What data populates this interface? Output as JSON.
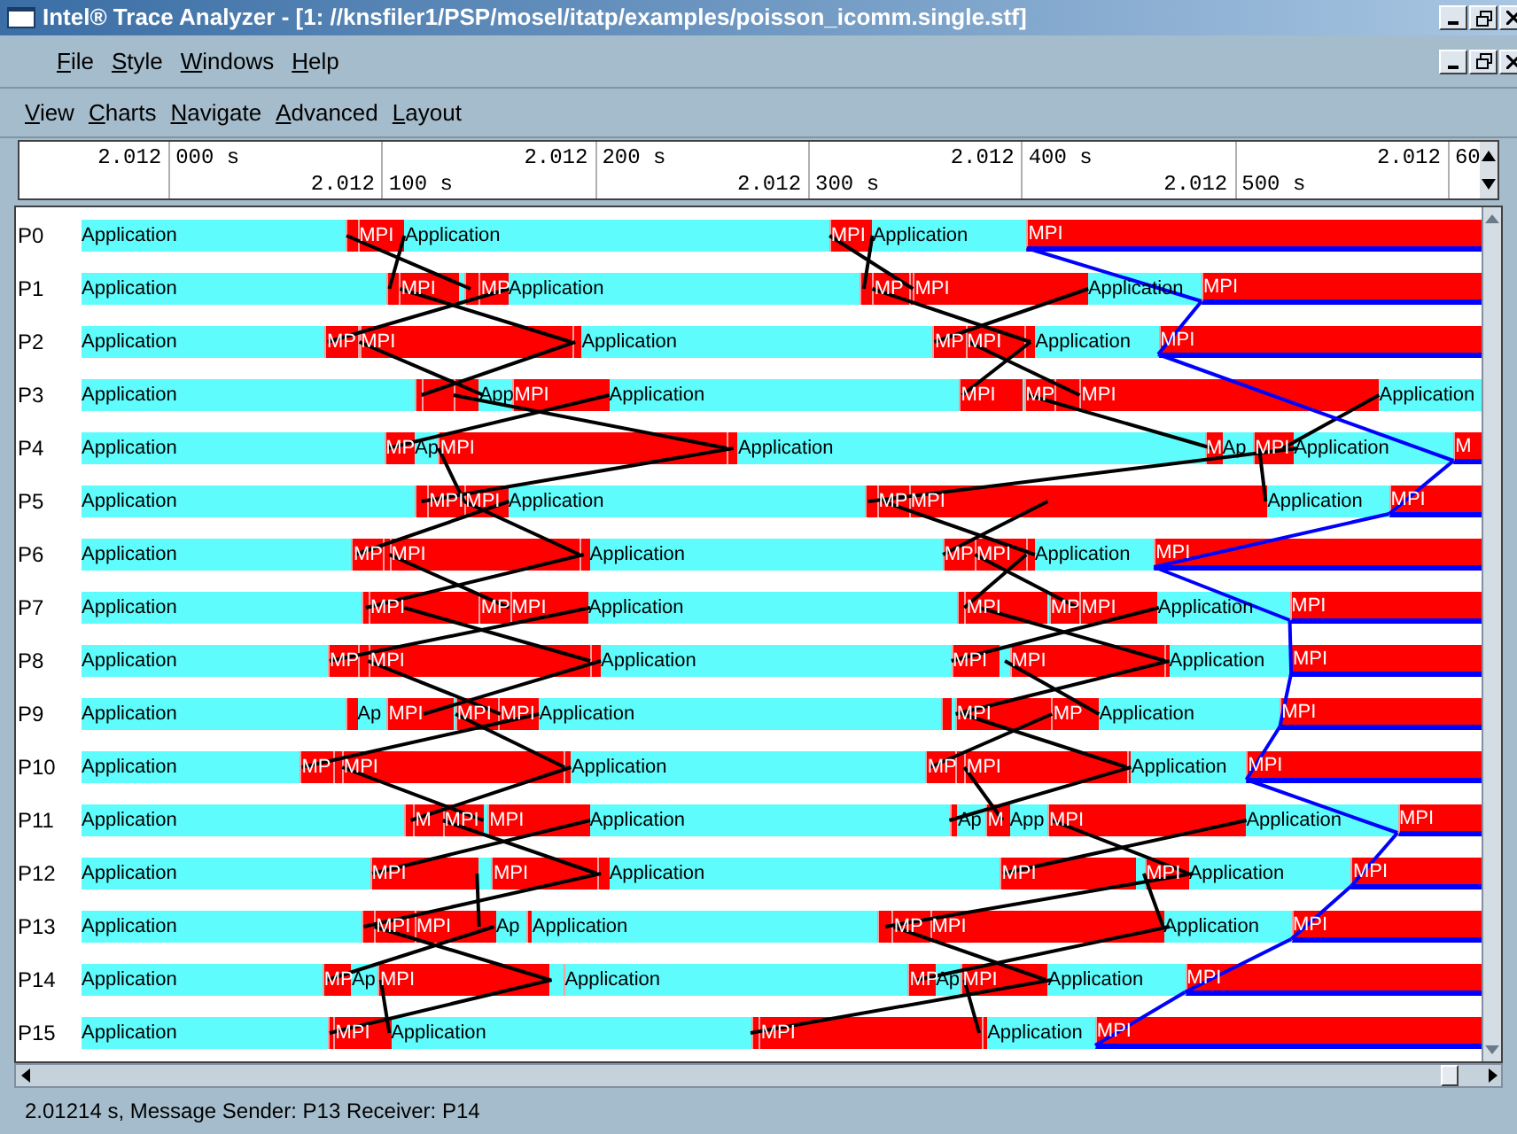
{
  "window": {
    "title": "Intel® Trace Analyzer - [1: //knsfiler1/PSP/mosel/itatp/examples/poisson_icomm.single.stf]"
  },
  "menu_bar": [
    "File",
    "Style",
    "Windows",
    "Help"
  ],
  "chart_menu": [
    "View",
    "Charts",
    "Navigate",
    "Advanced",
    "Layout"
  ],
  "ruler": {
    "ticks": [
      {
        "prefix": "2.012",
        "suffix": "000 s"
      },
      {
        "prefix": "2.012",
        "suffix": "100 s"
      },
      {
        "prefix": "2.012",
        "suffix": "200 s"
      },
      {
        "prefix": "2.012",
        "suffix": "300 s"
      },
      {
        "prefix": "2.012",
        "suffix": "400 s"
      },
      {
        "prefix": "2.012",
        "suffix": "500 s"
      },
      {
        "prefix": "2.012",
        "suffix": "60"
      }
    ]
  },
  "trace": {
    "rows": [
      {
        "process": "P0",
        "segments": [
          {
            "kind": "app",
            "label": "Application"
          },
          {
            "kind": "mpi"
          },
          {
            "kind": "mpi",
            "label": "MPI"
          },
          {
            "kind": "app",
            "label": "Application"
          },
          {
            "kind": "mpi",
            "label": "MPI"
          },
          {
            "kind": "app",
            "label": "Application"
          },
          {
            "kind": "mpi",
            "label": "MPI",
            "collective": true
          }
        ]
      },
      {
        "process": "P1",
        "segments": [
          {
            "kind": "app",
            "label": "Application"
          },
          {
            "kind": "mpi"
          },
          {
            "kind": "mpi",
            "label": "MPI"
          },
          {
            "kind": "app"
          },
          {
            "kind": "mpi"
          },
          {
            "kind": "mpi",
            "label": "MP"
          },
          {
            "kind": "app",
            "label": "Application"
          },
          {
            "kind": "mpi"
          },
          {
            "kind": "mpi",
            "label": "MP"
          },
          {
            "kind": "mpi"
          },
          {
            "kind": "mpi",
            "label": "MPI"
          },
          {
            "kind": "app",
            "label": "Application"
          },
          {
            "kind": "mpi",
            "label": "MPI",
            "collective": true
          }
        ]
      },
      {
        "process": "P2",
        "segments": [
          {
            "kind": "app",
            "label": "Application"
          },
          {
            "kind": "mpi",
            "label": "MP"
          },
          {
            "kind": "mpi"
          },
          {
            "kind": "mpi",
            "label": "MPI"
          },
          {
            "kind": "mpi"
          },
          {
            "kind": "app",
            "label": "Application"
          },
          {
            "kind": "mpi",
            "label": "MP"
          },
          {
            "kind": "mpi",
            "label": "MPI"
          },
          {
            "kind": "mpi"
          },
          {
            "kind": "app",
            "label": "Application"
          },
          {
            "kind": "mpi",
            "label": "MPI",
            "collective": true
          }
        ]
      },
      {
        "process": "P3",
        "segments": [
          {
            "kind": "app",
            "label": "Application"
          },
          {
            "kind": "mpi"
          },
          {
            "kind": "mpi"
          },
          {
            "kind": "mpi"
          },
          {
            "kind": "app",
            "label": "App"
          },
          {
            "kind": "mpi",
            "label": "MPI"
          },
          {
            "kind": "app",
            "label": "Application"
          },
          {
            "kind": "mpi",
            "label": "MPI"
          },
          {
            "kind": "app"
          },
          {
            "kind": "mpi",
            "label": "MP"
          },
          {
            "kind": "mpi"
          },
          {
            "kind": "mpi",
            "label": "MPI"
          },
          {
            "kind": "app",
            "label": "Application"
          }
        ]
      },
      {
        "process": "P4",
        "segments": [
          {
            "kind": "app",
            "label": "Application"
          },
          {
            "kind": "mpi",
            "label": "MP"
          },
          {
            "kind": "app",
            "label": "Ap"
          },
          {
            "kind": "mpi",
            "label": "MPI"
          },
          {
            "kind": "mpi"
          },
          {
            "kind": "app",
            "label": "Application"
          },
          {
            "kind": "mpi",
            "label": "M"
          },
          {
            "kind": "app",
            "label": "Ap"
          },
          {
            "kind": "mpi",
            "label": "MPI"
          },
          {
            "kind": "app",
            "label": "Application"
          },
          {
            "kind": "mpi",
            "label": "M",
            "collective": true
          }
        ]
      },
      {
        "process": "P5",
        "segments": [
          {
            "kind": "app",
            "label": "Application"
          },
          {
            "kind": "mpi"
          },
          {
            "kind": "mpi",
            "label": "MPI"
          },
          {
            "kind": "mpi",
            "label": "MPI"
          },
          {
            "kind": "app",
            "label": "Application"
          },
          {
            "kind": "mpi"
          },
          {
            "kind": "mpi",
            "label": "MP"
          },
          {
            "kind": "mpi",
            "label": "MPI"
          },
          {
            "kind": "app",
            "label": "Application"
          },
          {
            "kind": "mpi",
            "label": "MPI",
            "collective": true
          }
        ]
      },
      {
        "process": "P6",
        "segments": [
          {
            "kind": "app",
            "label": "Application"
          },
          {
            "kind": "mpi",
            "label": "MP"
          },
          {
            "kind": "mpi"
          },
          {
            "kind": "mpi",
            "label": "MPI"
          },
          {
            "kind": "mpi"
          },
          {
            "kind": "app",
            "label": "Application"
          },
          {
            "kind": "mpi",
            "label": "MP"
          },
          {
            "kind": "mpi",
            "label": "MPI"
          },
          {
            "kind": "mpi"
          },
          {
            "kind": "app",
            "label": "Application"
          },
          {
            "kind": "mpi",
            "label": "MPI",
            "collective": true
          }
        ]
      },
      {
        "process": "P7",
        "segments": [
          {
            "kind": "app",
            "label": "Application"
          },
          {
            "kind": "mpi"
          },
          {
            "kind": "mpi",
            "label": "MPI"
          },
          {
            "kind": "app"
          },
          {
            "kind": "mpi",
            "label": "MP"
          },
          {
            "kind": "mpi",
            "label": "MPI"
          },
          {
            "kind": "app",
            "label": "Application"
          },
          {
            "kind": "mpi"
          },
          {
            "kind": "mpi",
            "label": "MPI"
          },
          {
            "kind": "app"
          },
          {
            "kind": "mpi",
            "label": "MP"
          },
          {
            "kind": "mpi",
            "label": "MPI"
          },
          {
            "kind": "app",
            "label": "Application"
          },
          {
            "kind": "mpi",
            "label": "MPI",
            "collective": true
          }
        ]
      },
      {
        "process": "P8",
        "segments": [
          {
            "kind": "app",
            "label": "Application"
          },
          {
            "kind": "mpi",
            "label": "MP"
          },
          {
            "kind": "mpi"
          },
          {
            "kind": "mpi",
            "label": "MPI"
          },
          {
            "kind": "mpi"
          },
          {
            "kind": "app",
            "label": "Application"
          },
          {
            "kind": "mpi",
            "label": "MPI"
          },
          {
            "kind": "app"
          },
          {
            "kind": "mpi",
            "label": "MPI"
          },
          {
            "kind": "mpi"
          },
          {
            "kind": "app",
            "label": "Application"
          },
          {
            "kind": "mpi",
            "label": "MPI",
            "collective": true
          }
        ]
      },
      {
        "process": "P9",
        "segments": [
          {
            "kind": "app",
            "label": "Application"
          },
          {
            "kind": "mpi"
          },
          {
            "kind": "app",
            "label": "Ap"
          },
          {
            "kind": "mpi",
            "label": "MPI"
          },
          {
            "kind": "app"
          },
          {
            "kind": "mpi",
            "label": "MPI"
          },
          {
            "kind": "mpi",
            "label": "MPI"
          },
          {
            "kind": "app",
            "label": "Application"
          },
          {
            "kind": "mpi"
          },
          {
            "kind": "app"
          },
          {
            "kind": "mpi",
            "label": "MPI"
          },
          {
            "kind": "mpi",
            "label": "MP"
          },
          {
            "kind": "app",
            "label": "Application"
          },
          {
            "kind": "mpi",
            "label": "MPI",
            "collective": true
          }
        ]
      },
      {
        "process": "P10",
        "segments": [
          {
            "kind": "app",
            "label": "Application"
          },
          {
            "kind": "mpi",
            "label": "MP"
          },
          {
            "kind": "mpi"
          },
          {
            "kind": "mpi",
            "label": "MPI"
          },
          {
            "kind": "mpi"
          },
          {
            "kind": "app",
            "label": "Application"
          },
          {
            "kind": "mpi",
            "label": "MP"
          },
          {
            "kind": "mpi"
          },
          {
            "kind": "mpi",
            "label": "MPI"
          },
          {
            "kind": "mpi"
          },
          {
            "kind": "app",
            "label": "Application"
          },
          {
            "kind": "mpi",
            "label": "MPI",
            "collective": true
          }
        ]
      },
      {
        "process": "P11",
        "segments": [
          {
            "kind": "app",
            "label": "Application"
          },
          {
            "kind": "mpi"
          },
          {
            "kind": "mpi",
            "label": "M"
          },
          {
            "kind": "mpi",
            "label": "MPI"
          },
          {
            "kind": "app"
          },
          {
            "kind": "mpi",
            "label": "MPI"
          },
          {
            "kind": "app",
            "label": "Application"
          },
          {
            "kind": "mpi"
          },
          {
            "kind": "app",
            "label": "Ap"
          },
          {
            "kind": "mpi",
            "label": "M"
          },
          {
            "kind": "app",
            "label": "App"
          },
          {
            "kind": "mpi",
            "label": "MPI"
          },
          {
            "kind": "app",
            "label": "Application"
          },
          {
            "kind": "mpi",
            "label": "MPI",
            "collective": true
          }
        ]
      },
      {
        "process": "P12",
        "segments": [
          {
            "kind": "app",
            "label": "Application"
          },
          {
            "kind": "mpi",
            "label": "MPI"
          },
          {
            "kind": "app"
          },
          {
            "kind": "mpi",
            "label": "MPI"
          },
          {
            "kind": "mpi"
          },
          {
            "kind": "app",
            "label": "Application"
          },
          {
            "kind": "mpi",
            "label": "MPI"
          },
          {
            "kind": "app"
          },
          {
            "kind": "mpi",
            "label": "MPI"
          },
          {
            "kind": "app",
            "label": "Application"
          },
          {
            "kind": "mpi",
            "label": "MPI",
            "collective": true
          }
        ]
      },
      {
        "process": "P13",
        "segments": [
          {
            "kind": "app",
            "label": "Application"
          },
          {
            "kind": "mpi"
          },
          {
            "kind": "mpi",
            "label": "MPI"
          },
          {
            "kind": "mpi",
            "label": "MPI"
          },
          {
            "kind": "app",
            "label": "Ap"
          },
          {
            "kind": "mpi"
          },
          {
            "kind": "app",
            "label": "Application"
          },
          {
            "kind": "mpi"
          },
          {
            "kind": "mpi",
            "label": "MP"
          },
          {
            "kind": "mpi",
            "label": "MPI"
          },
          {
            "kind": "app",
            "label": "Application"
          },
          {
            "kind": "mpi",
            "label": "MPI",
            "collective": true
          }
        ]
      },
      {
        "process": "P14",
        "segments": [
          {
            "kind": "app",
            "label": "Application"
          },
          {
            "kind": "mpi",
            "label": "MP"
          },
          {
            "kind": "app",
            "label": "Ap"
          },
          {
            "kind": "mpi",
            "label": "MPI"
          },
          {
            "kind": "app"
          },
          {
            "kind": "mpi"
          },
          {
            "kind": "app",
            "label": "Application"
          },
          {
            "kind": "mpi",
            "label": "MP"
          },
          {
            "kind": "app",
            "label": "Ap"
          },
          {
            "kind": "mpi",
            "label": "MPI"
          },
          {
            "kind": "app",
            "label": "Application"
          },
          {
            "kind": "mpi",
            "label": "MPI",
            "collective": true
          }
        ]
      },
      {
        "process": "P15",
        "segments": [
          {
            "kind": "app",
            "label": "Application"
          },
          {
            "kind": "mpi"
          },
          {
            "kind": "mpi",
            "label": "MPI"
          },
          {
            "kind": "app",
            "label": "Application"
          },
          {
            "kind": "mpi"
          },
          {
            "kind": "mpi",
            "label": "MPI"
          },
          {
            "kind": "mpi"
          },
          {
            "kind": "app",
            "label": "Application"
          },
          {
            "kind": "mpi",
            "label": "MPI",
            "collective": true
          }
        ]
      }
    ]
  },
  "status_bar": {
    "text": "2.01214 s, Message Sender: P13 Receiver: P14"
  }
}
